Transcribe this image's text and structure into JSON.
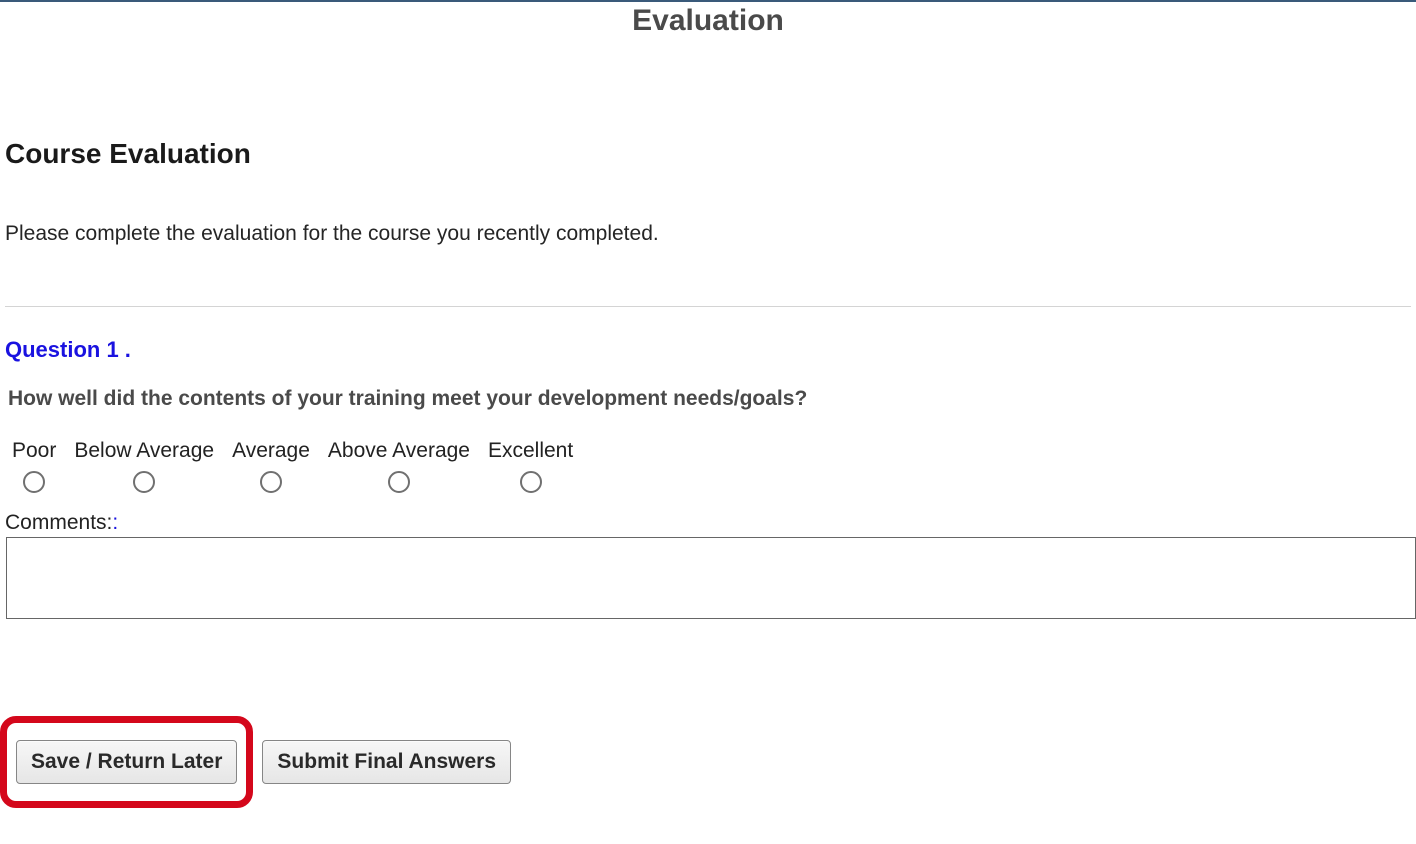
{
  "page_title": "Evaluation",
  "section_heading": "Course Evaluation",
  "intro_text": "Please complete the evaluation for the course you recently completed.",
  "question": {
    "header": "Question 1 .",
    "text": "How well did the contents of your training meet your development needs/goals?",
    "ratings": [
      "Poor",
      "Below Average",
      "Average",
      "Above Average",
      "Excellent"
    ],
    "comments_label": "Comments:",
    "comments_value": ""
  },
  "buttons": {
    "save": "Save / Return Later",
    "submit": "Submit Final Answers"
  }
}
